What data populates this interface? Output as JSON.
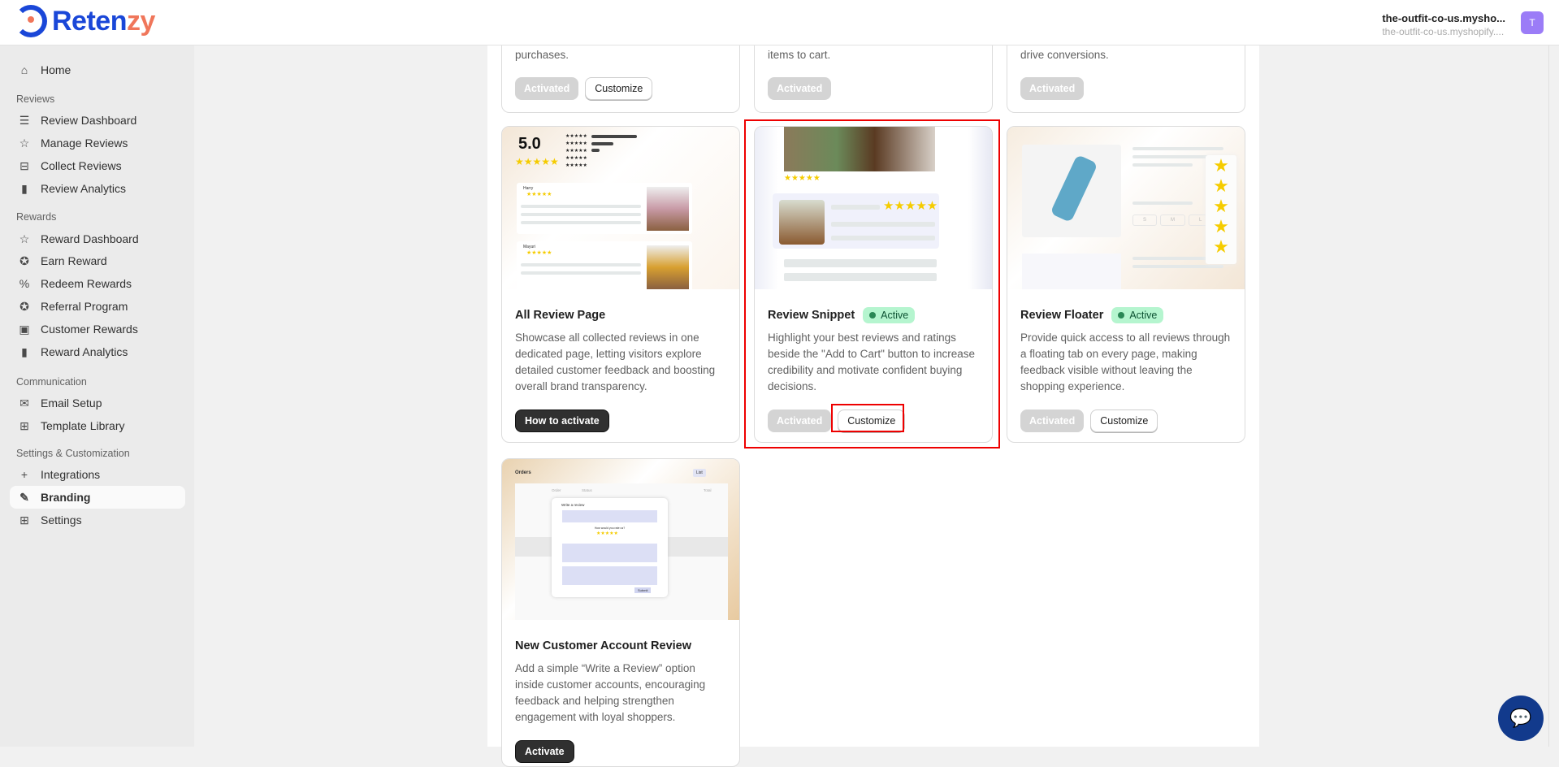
{
  "brand": {
    "name_a": "Reten",
    "name_b": "zy"
  },
  "account": {
    "store_name": "the-outfit-co-us.mysho...",
    "store_domain": "the-outfit-co-us.myshopify....",
    "avatar_letter": "T"
  },
  "sidebar": {
    "home": "Home",
    "sections": [
      {
        "title": "Reviews",
        "items": [
          "Review Dashboard",
          "Manage Reviews",
          "Collect Reviews",
          "Review Analytics"
        ]
      },
      {
        "title": "Rewards",
        "items": [
          "Reward Dashboard",
          "Earn Reward",
          "Redeem Rewards",
          "Referral Program",
          "Customer Rewards",
          "Reward Analytics"
        ]
      },
      {
        "title": "Communication",
        "items": [
          "Email Setup",
          "Template Library"
        ]
      },
      {
        "title": "Settings & Customization",
        "items": [
          "Integrations",
          "Branding",
          "Settings"
        ]
      }
    ],
    "active": "Branding"
  },
  "top_cards": [
    {
      "desc_tail": "purchases.",
      "activated": "Activated",
      "customize": "Customize"
    },
    {
      "desc_tail": "items to cart.",
      "activated": "Activated"
    },
    {
      "desc_tail": "drive conversions.",
      "activated": "Activated"
    }
  ],
  "cards": [
    {
      "title": "All Review Page",
      "desc": "Showcase all collected reviews in one dedicated page, letting visitors explore detailed customer feedback and boosting overall brand transparency.",
      "button": "How to activate",
      "preview": {
        "rating": "5.0",
        "reviewer1": "Harry",
        "reviewer2": "Mayuri"
      }
    },
    {
      "title": "Review Snippet",
      "badge": "Active",
      "desc": "Highlight your best reviews and ratings beside the \"Add to Cart\" button to increase credibility and motivate confident buying decisions.",
      "activated": "Activated",
      "customize": "Customize"
    },
    {
      "title": "Review Floater",
      "badge": "Active",
      "desc": "Provide quick access to all reviews through a floating tab on every page, making feedback visible without leaving the shopping experience.",
      "activated": "Activated",
      "customize": "Customize",
      "preview": {
        "sizes": [
          "S",
          "M",
          "L"
        ]
      }
    },
    {
      "title": "New Customer Account Review",
      "desc": "Add a simple “Write a Review” option inside customer accounts, encouraging feedback and helping strengthen engagement with loyal shoppers.",
      "button": "Activate",
      "preview": {
        "heading": "Orders",
        "col_order": "Order",
        "col_status": "Status",
        "col_total": "Total",
        "list": "List",
        "modal_title": "Write a review",
        "rate_q": "How would you rate us?",
        "submit": "Submit"
      }
    }
  ],
  "colors": {
    "accent": "#1a47d8",
    "logo_accent": "#f0765a",
    "highlight": "#ee0000",
    "badge_bg": "#b5f5cf"
  }
}
